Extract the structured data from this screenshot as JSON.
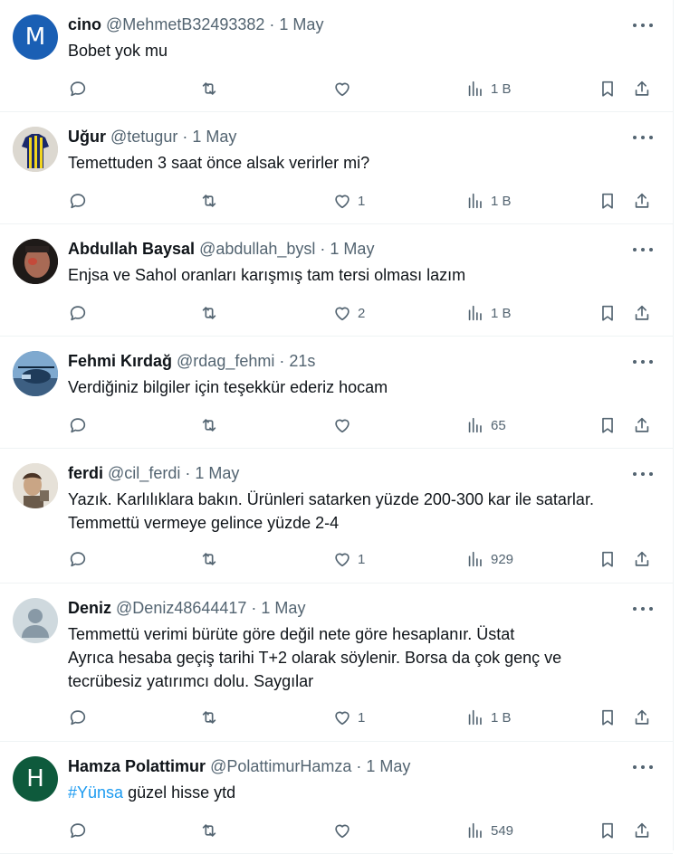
{
  "tweets": [
    {
      "name": "cino",
      "handle": "@MehmetB32493382",
      "time": "1 May",
      "text": "Bobet yok mu",
      "likes": "",
      "views": "1 B",
      "avatar": {
        "type": "letter",
        "letter": "M",
        "color": "#1a5fb4"
      }
    },
    {
      "name": "Uğur",
      "handle": "@tetugur",
      "time": "1 May",
      "text": "Temettuden 3 saat önce alsak verirler mi?",
      "likes": "1",
      "views": "1 B",
      "avatar": {
        "type": "jersey",
        "color": "#d8d4cc"
      }
    },
    {
      "name": "Abdullah Baysal",
      "handle": "@abdullah_bysl",
      "time": "1 May",
      "text": "Enjsa ve Sahol oranları karışmış tam tersi olması lazım",
      "likes": "2",
      "views": "1 B",
      "avatar": {
        "type": "face-dark",
        "color": "#2b2420"
      }
    },
    {
      "name": "Fehmi Kırdağ",
      "handle": "@rdag_fehmi",
      "time": "21s",
      "text": "Verdiğiniz bilgiler için teşekkür ederiz hocam",
      "likes": "",
      "views": "65",
      "avatar": {
        "type": "helicopter",
        "color": "#4a7fb0"
      }
    },
    {
      "name": "ferdi",
      "handle": "@cil_ferdi",
      "time": "1 May",
      "text": "Yazık. Karlılıklara bakın. Ürünleri satarken yüzde 200-300 kar ile satarlar.\nTemmettü vermeye gelince yüzde 2-4",
      "likes": "1",
      "views": "929",
      "avatar": {
        "type": "face-light",
        "color": "#d9d2c6"
      }
    },
    {
      "name": "Deniz",
      "handle": "@Deniz48644417",
      "time": "1 May",
      "text": "Temmettü verimi bürüte göre değil nete göre hesaplanır. Üstat\nAyrıca hesaba geçiş tarihi  T+2 olarak söylenir. Borsa da çok genç ve\ntecrübesiz yatırımcı dolu.  Saygılar",
      "likes": "1",
      "views": "1 B",
      "avatar": {
        "type": "default",
        "color": "#cfd9de"
      }
    },
    {
      "name": "Hamza Polattimur",
      "handle": "@PolattimurHamza",
      "time": "1 May",
      "hashtag": "#Yünsa",
      "text": " güzel hisse ytd",
      "likes": "",
      "views": "549",
      "avatar": {
        "type": "letter",
        "letter": "H",
        "color": "#0e5a3c"
      }
    }
  ],
  "separator": " · "
}
